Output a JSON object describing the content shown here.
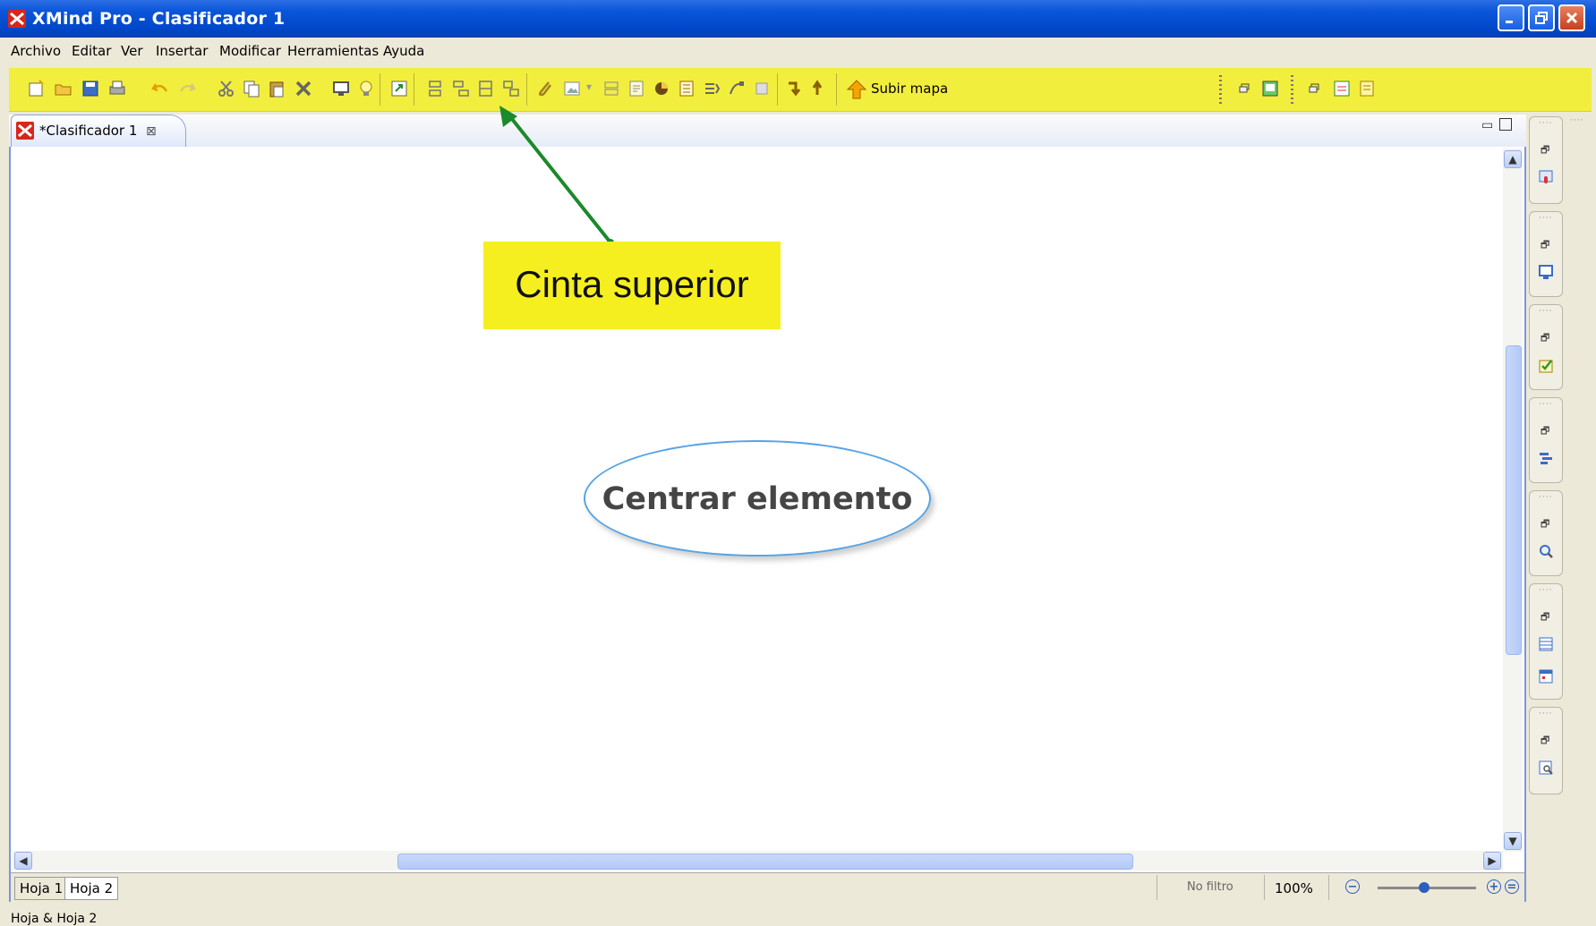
{
  "window": {
    "title": "XMind Pro - Clasificador 1",
    "icon": "xmind-logo-icon",
    "controls": [
      "minimize-icon",
      "restore-icon",
      "close-icon"
    ]
  },
  "menu": [
    "Archivo",
    "Editar",
    "Ver",
    "Insertar",
    "Modificar",
    "Herramientas",
    "Ayuda"
  ],
  "toolbar": {
    "subir_mapa_label": "Subir mapa",
    "color": "#f2ee3e"
  },
  "editor": {
    "tab_label": "*Clasificador 1",
    "central_topic": "Centrar elemento"
  },
  "annotation": {
    "label": "Cinta superior",
    "color": "#f6ef20",
    "arrow_color": "#1a8a2a"
  },
  "sheets": [
    "Hoja 1",
    "Hoja 2"
  ],
  "status": {
    "filter": "No filtro",
    "zoom": "100%",
    "zoom_minus": "−",
    "zoom_plus": "+",
    "zoom_reset": "=",
    "statusline": "Hoja & Hoja 2"
  }
}
